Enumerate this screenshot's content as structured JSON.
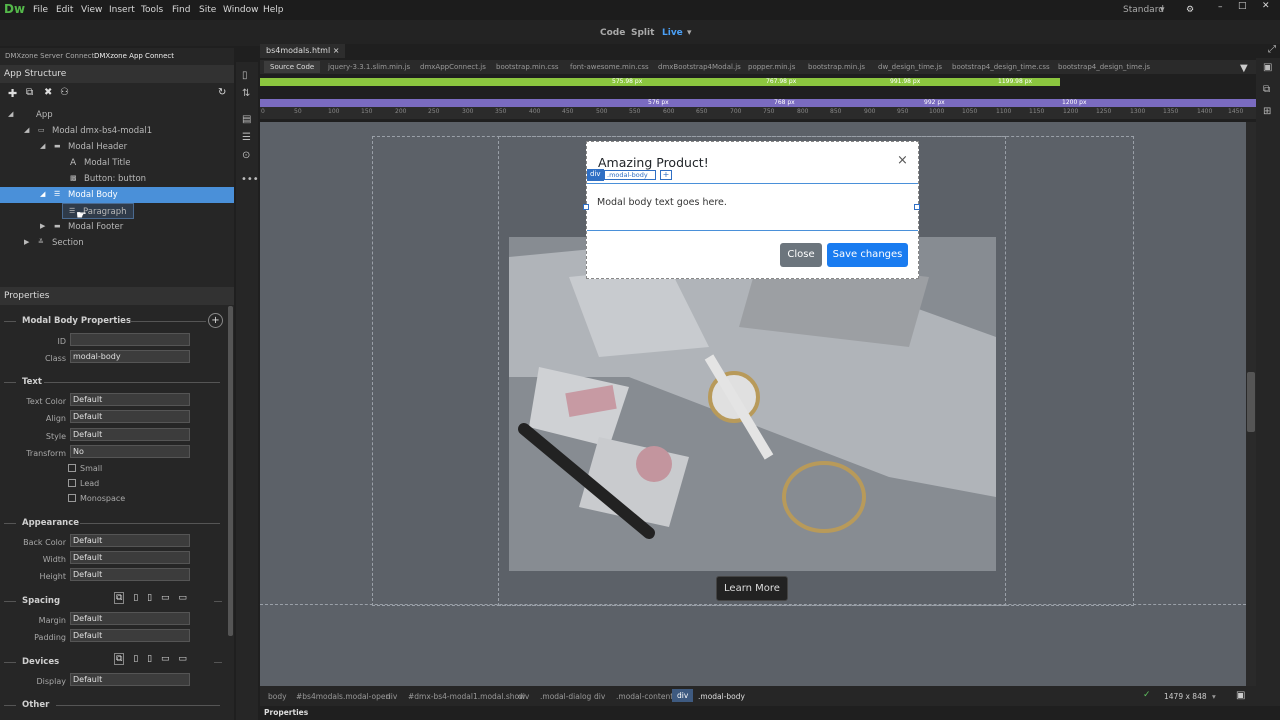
{
  "app": {
    "logo": "Dw",
    "layout_mode": "Standard"
  },
  "menu": [
    "File",
    "Edit",
    "View",
    "Insert",
    "Tools",
    "Find",
    "Site",
    "Window",
    "Help"
  ],
  "view_switch": {
    "code": "Code",
    "split": "Split",
    "live": "Live"
  },
  "left_tabs": [
    "DMXzone Server Connect",
    "DMXzone App Connect"
  ],
  "app_structure": {
    "title": "App Structure",
    "tree": [
      {
        "label": "App"
      },
      {
        "label": "Modal dmx-bs4-modal1"
      },
      {
        "label": "Modal Header"
      },
      {
        "label": "Modal Title"
      },
      {
        "label": "Button: button"
      },
      {
        "label": "Modal Body"
      },
      {
        "label": "Paragraph"
      },
      {
        "label": "Modal Footer"
      },
      {
        "label": "Section"
      }
    ]
  },
  "properties": {
    "title": "Properties",
    "section_title": "Modal Body Properties",
    "id_label": "ID",
    "id_value": "",
    "class_label": "Class",
    "class_value": "modal-body",
    "text_section": "Text",
    "text_color_label": "Text Color",
    "text_color": "Default",
    "align_label": "Align",
    "align": "Default",
    "style_label": "Style",
    "style": "Default",
    "transform_label": "Transform",
    "transform": "No",
    "checks": [
      "Small",
      "Lead",
      "Monospace"
    ],
    "appearance_section": "Appearance",
    "back_color_label": "Back Color",
    "back_color": "Default",
    "width_label": "Width",
    "width": "Default",
    "height_label": "Height",
    "height": "Default",
    "spacing_section": "Spacing",
    "margin_label": "Margin",
    "margin": "Default",
    "padding_label": "Padding",
    "padding": "Default",
    "devices_section": "Devices",
    "display_label": "Display",
    "display": "Default",
    "other_section": "Other"
  },
  "file_tab": "bs4modals.html",
  "related_files": [
    "Source Code",
    "jquery-3.3.1.slim.min.js",
    "dmxAppConnect.js",
    "bootstrap.min.css",
    "font-awesome.min.css",
    "dmxBootstrap4Modal.js",
    "popper.min.js",
    "bootstrap.min.js",
    "dw_design_time.js",
    "bootstrap4_design_time.css",
    "bootstrap4_design_time.js"
  ],
  "media_queries": {
    "green": [
      "575.98 px",
      "767.98 px",
      "991.98 px",
      "1199.98 px"
    ],
    "purple": [
      "576 px",
      "768 px",
      "992 px",
      "1200 px"
    ]
  },
  "ruler_ticks": [
    "0",
    "50",
    "100",
    "150",
    "200",
    "250",
    "300",
    "350",
    "400",
    "450",
    "500",
    "550",
    "600",
    "650",
    "700",
    "750",
    "800",
    "850",
    "900",
    "950",
    "1000",
    "1050",
    "1100",
    "1150",
    "1200",
    "1250",
    "1300",
    "1350",
    "1400",
    "1450"
  ],
  "modal": {
    "title": "Amazing Product!",
    "close_glyph": "×",
    "body_text": "Modal body text goes here.",
    "badge_tag": "div",
    "badge_class": ".modal-body",
    "badge_plus": "+",
    "close_button": "Close",
    "save_button": "Save changes"
  },
  "page": {
    "learn_more": "Learn More"
  },
  "breadcrumbs": [
    "body",
    "#bs4modals.modal-open",
    "div",
    "#dmx-bs4-modal1.modal.show",
    "div",
    ".modal-dialog",
    "div",
    ".modal-content",
    "div",
    ".modal-body"
  ],
  "viewport_size": "1479 x 848",
  "bottom_tab": "Properties"
}
